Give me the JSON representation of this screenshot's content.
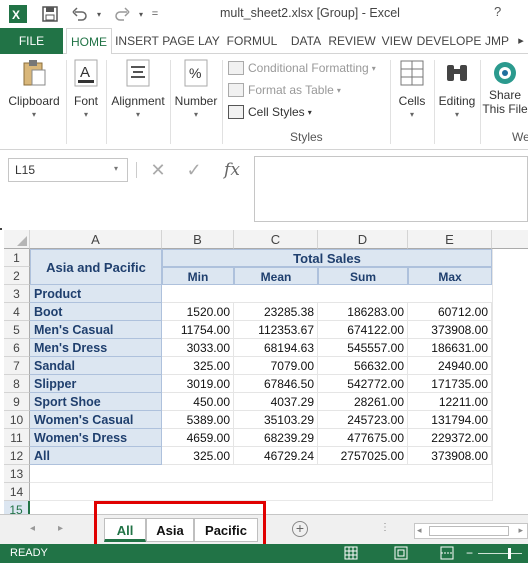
{
  "window": {
    "title": "mult_sheet2.xlsx  [Group] - Excel",
    "help": "?"
  },
  "quick_access": {
    "app_icon": "excel-icon",
    "save_icon": "save-icon",
    "undo_icon": "undo-icon",
    "redo_icon": "redo-icon",
    "customize": "="
  },
  "ribbon_tabs": [
    "FILE",
    "HOME",
    "INSERT",
    "PAGE LAY",
    "FORMUL",
    "DATA",
    "REVIEW",
    "VIEW",
    "DEVELOPE",
    "JMP"
  ],
  "ribbon": {
    "clipboard": "Clipboard",
    "font": "Font",
    "alignment": "Alignment",
    "number": "Number",
    "conditional_formatting": "Conditional Formatting",
    "format_as_table": "Format as Table",
    "cell_styles": "Cell Styles",
    "styles_group": "Styles",
    "cells": "Cells",
    "editing": "Editing",
    "share_line1": "Share",
    "share_line2": "This File",
    "share_group": "We"
  },
  "formula_bar": {
    "name_box": "L15",
    "cancel": "✕",
    "enter": "✓",
    "fx": "fx",
    "value": ""
  },
  "columns": [
    "A",
    "B",
    "C",
    "D",
    "E"
  ],
  "rows": [
    "1",
    "2",
    "3",
    "4",
    "5",
    "6",
    "7",
    "8",
    "9",
    "10",
    "11",
    "12",
    "13",
    "14",
    "15"
  ],
  "table": {
    "region_header": "Asia and Pacific",
    "total_sales": "Total Sales",
    "stat_headers": [
      "Min",
      "Mean",
      "Sum",
      "Max"
    ],
    "product_header": "Product",
    "products": [
      {
        "name": "Boot",
        "values": [
          "1520.00",
          "23285.38",
          "186283.00",
          "60712.00"
        ]
      },
      {
        "name": "Men's Casual",
        "values": [
          "11754.00",
          "112353.67",
          "674122.00",
          "373908.00"
        ]
      },
      {
        "name": "Men's Dress",
        "values": [
          "3033.00",
          "68194.63",
          "545557.00",
          "186631.00"
        ]
      },
      {
        "name": "Sandal",
        "values": [
          "325.00",
          "7079.00",
          "56632.00",
          "24940.00"
        ]
      },
      {
        "name": "Slipper",
        "values": [
          "3019.00",
          "67846.50",
          "542772.00",
          "171735.00"
        ]
      },
      {
        "name": "Sport Shoe",
        "values": [
          "450.00",
          "4037.29",
          "28261.00",
          "12211.00"
        ]
      },
      {
        "name": "Women's Casual",
        "values": [
          "5389.00",
          "35103.29",
          "245723.00",
          "131794.00"
        ]
      },
      {
        "name": "Women's Dress",
        "values": [
          "4659.00",
          "68239.29",
          "477675.00",
          "229372.00"
        ]
      },
      {
        "name": "All",
        "values": [
          "325.00",
          "46729.24",
          "2757025.00",
          "373908.00"
        ]
      }
    ]
  },
  "sheet_tabs": [
    "All",
    "Asia",
    "Pacific"
  ],
  "active_sheet": "All",
  "status": "READY",
  "colors": {
    "excel_green": "#217346",
    "header_fill": "#dce6f1",
    "header_text": "#1f3f6e",
    "highlight": "#e00000"
  }
}
